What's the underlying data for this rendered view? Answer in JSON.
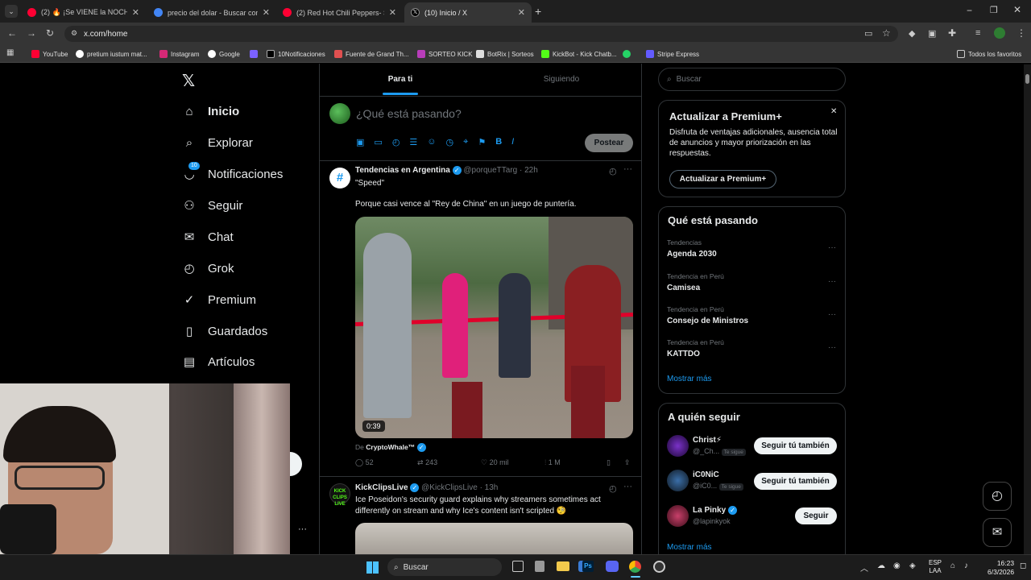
{
  "browser": {
    "tabs": [
      {
        "title": "(2) 🔥 ¡Se VIENE la NOCHE DO",
        "color": "#ff0033"
      },
      {
        "title": "precio del dolar - Buscar con G",
        "color": "#4285f4"
      },
      {
        "title": "(2) Red Hot Chili Peppers- Scar",
        "color": "#ff0033"
      },
      {
        "title": "(10) Inicio / X",
        "color": "#000000"
      }
    ],
    "url": "x.com/home",
    "bookmarks": [
      "YouTube",
      "pretium iustum mat...",
      "Instagram",
      "Google",
      "10Notificaciones",
      "Fuente de Grand Th...",
      "SORTEO KICK",
      "BotRix | Sorteos",
      "KickBot - Kick Chatb...",
      "Stripe Express"
    ],
    "all_favorites": "Todos los favoritos"
  },
  "sidebar": {
    "items": [
      {
        "label": "Inicio",
        "icon": "⌂",
        "bold": true
      },
      {
        "label": "Explorar",
        "icon": "⌕"
      },
      {
        "label": "Notificaciones",
        "icon": "🔔",
        "badge": "10"
      },
      {
        "label": "Seguir",
        "icon": "⚇"
      },
      {
        "label": "Chat",
        "icon": "✉"
      },
      {
        "label": "Grok",
        "icon": "◴"
      },
      {
        "label": "Premium",
        "icon": "✓"
      },
      {
        "label": "Guardados",
        "icon": "▯"
      },
      {
        "label": "Artículos",
        "icon": "▤"
      }
    ],
    "more": "···"
  },
  "feed": {
    "tabs": {
      "for_you": "Para ti",
      "following": "Siguiendo"
    },
    "compose_placeholder": "¿Qué está pasando?",
    "post_button": "Postear",
    "tweet1": {
      "name": "Tendencias en Argentina",
      "handle": "@porqueTTarg",
      "time": "· 22h",
      "line1": "\"Speed\"",
      "line2": "Porque casi vence al \"Rey de China\" en un juego de puntería.",
      "duration": "0:39",
      "from_prefix": "De",
      "from_name": "CryptoWhale™",
      "replies": "52",
      "retweets": "243",
      "likes": "20 mil",
      "views": "1 M"
    },
    "tweet2": {
      "name": "KickClipsLive",
      "handle": "@KickClipsLive",
      "time": "· 13h",
      "text": "Ice Poseidon's security guard explains why streamers sometimes act differently on stream and why Ice's content isn't scripted 🧐"
    }
  },
  "right": {
    "search_placeholder": "Buscar",
    "premium": {
      "title": "Actualizar a Premium+",
      "text": "Disfruta de ventajas adicionales, ausencia total de anuncios y mayor priorización en las respuestas.",
      "button": "Actualizar a Premium+"
    },
    "trends_title": "Qué está pasando",
    "trends": [
      {
        "category": "Tendencias",
        "name": "Agenda 2030"
      },
      {
        "category": "Tendencia en Perú",
        "name": "Camisea"
      },
      {
        "category": "Tendencia en Perú",
        "name": "Consejo de Ministros"
      },
      {
        "category": "Tendencia en Perú",
        "name": "KATTDO"
      }
    ],
    "show_more": "Mostrar más",
    "who_title": "A quién seguir",
    "follows": [
      {
        "name": "Christ⚡",
        "handle": "@_Ch...",
        "tag": "Te sigue",
        "button": "Seguir tú también"
      },
      {
        "name": "iC0NiC",
        "handle": "@iC0...",
        "tag": "Te sigue",
        "button": "Seguir tú también"
      },
      {
        "name": "La Pinky",
        "handle": "@lapinkyok",
        "tag": "",
        "button": "Seguir"
      }
    ],
    "show_more2": "Mostrar más"
  },
  "taskbar": {
    "search": "Buscar",
    "lang1": "ESP",
    "lang2": "LAA",
    "time": "16:23",
    "date": "6/3/2026"
  }
}
